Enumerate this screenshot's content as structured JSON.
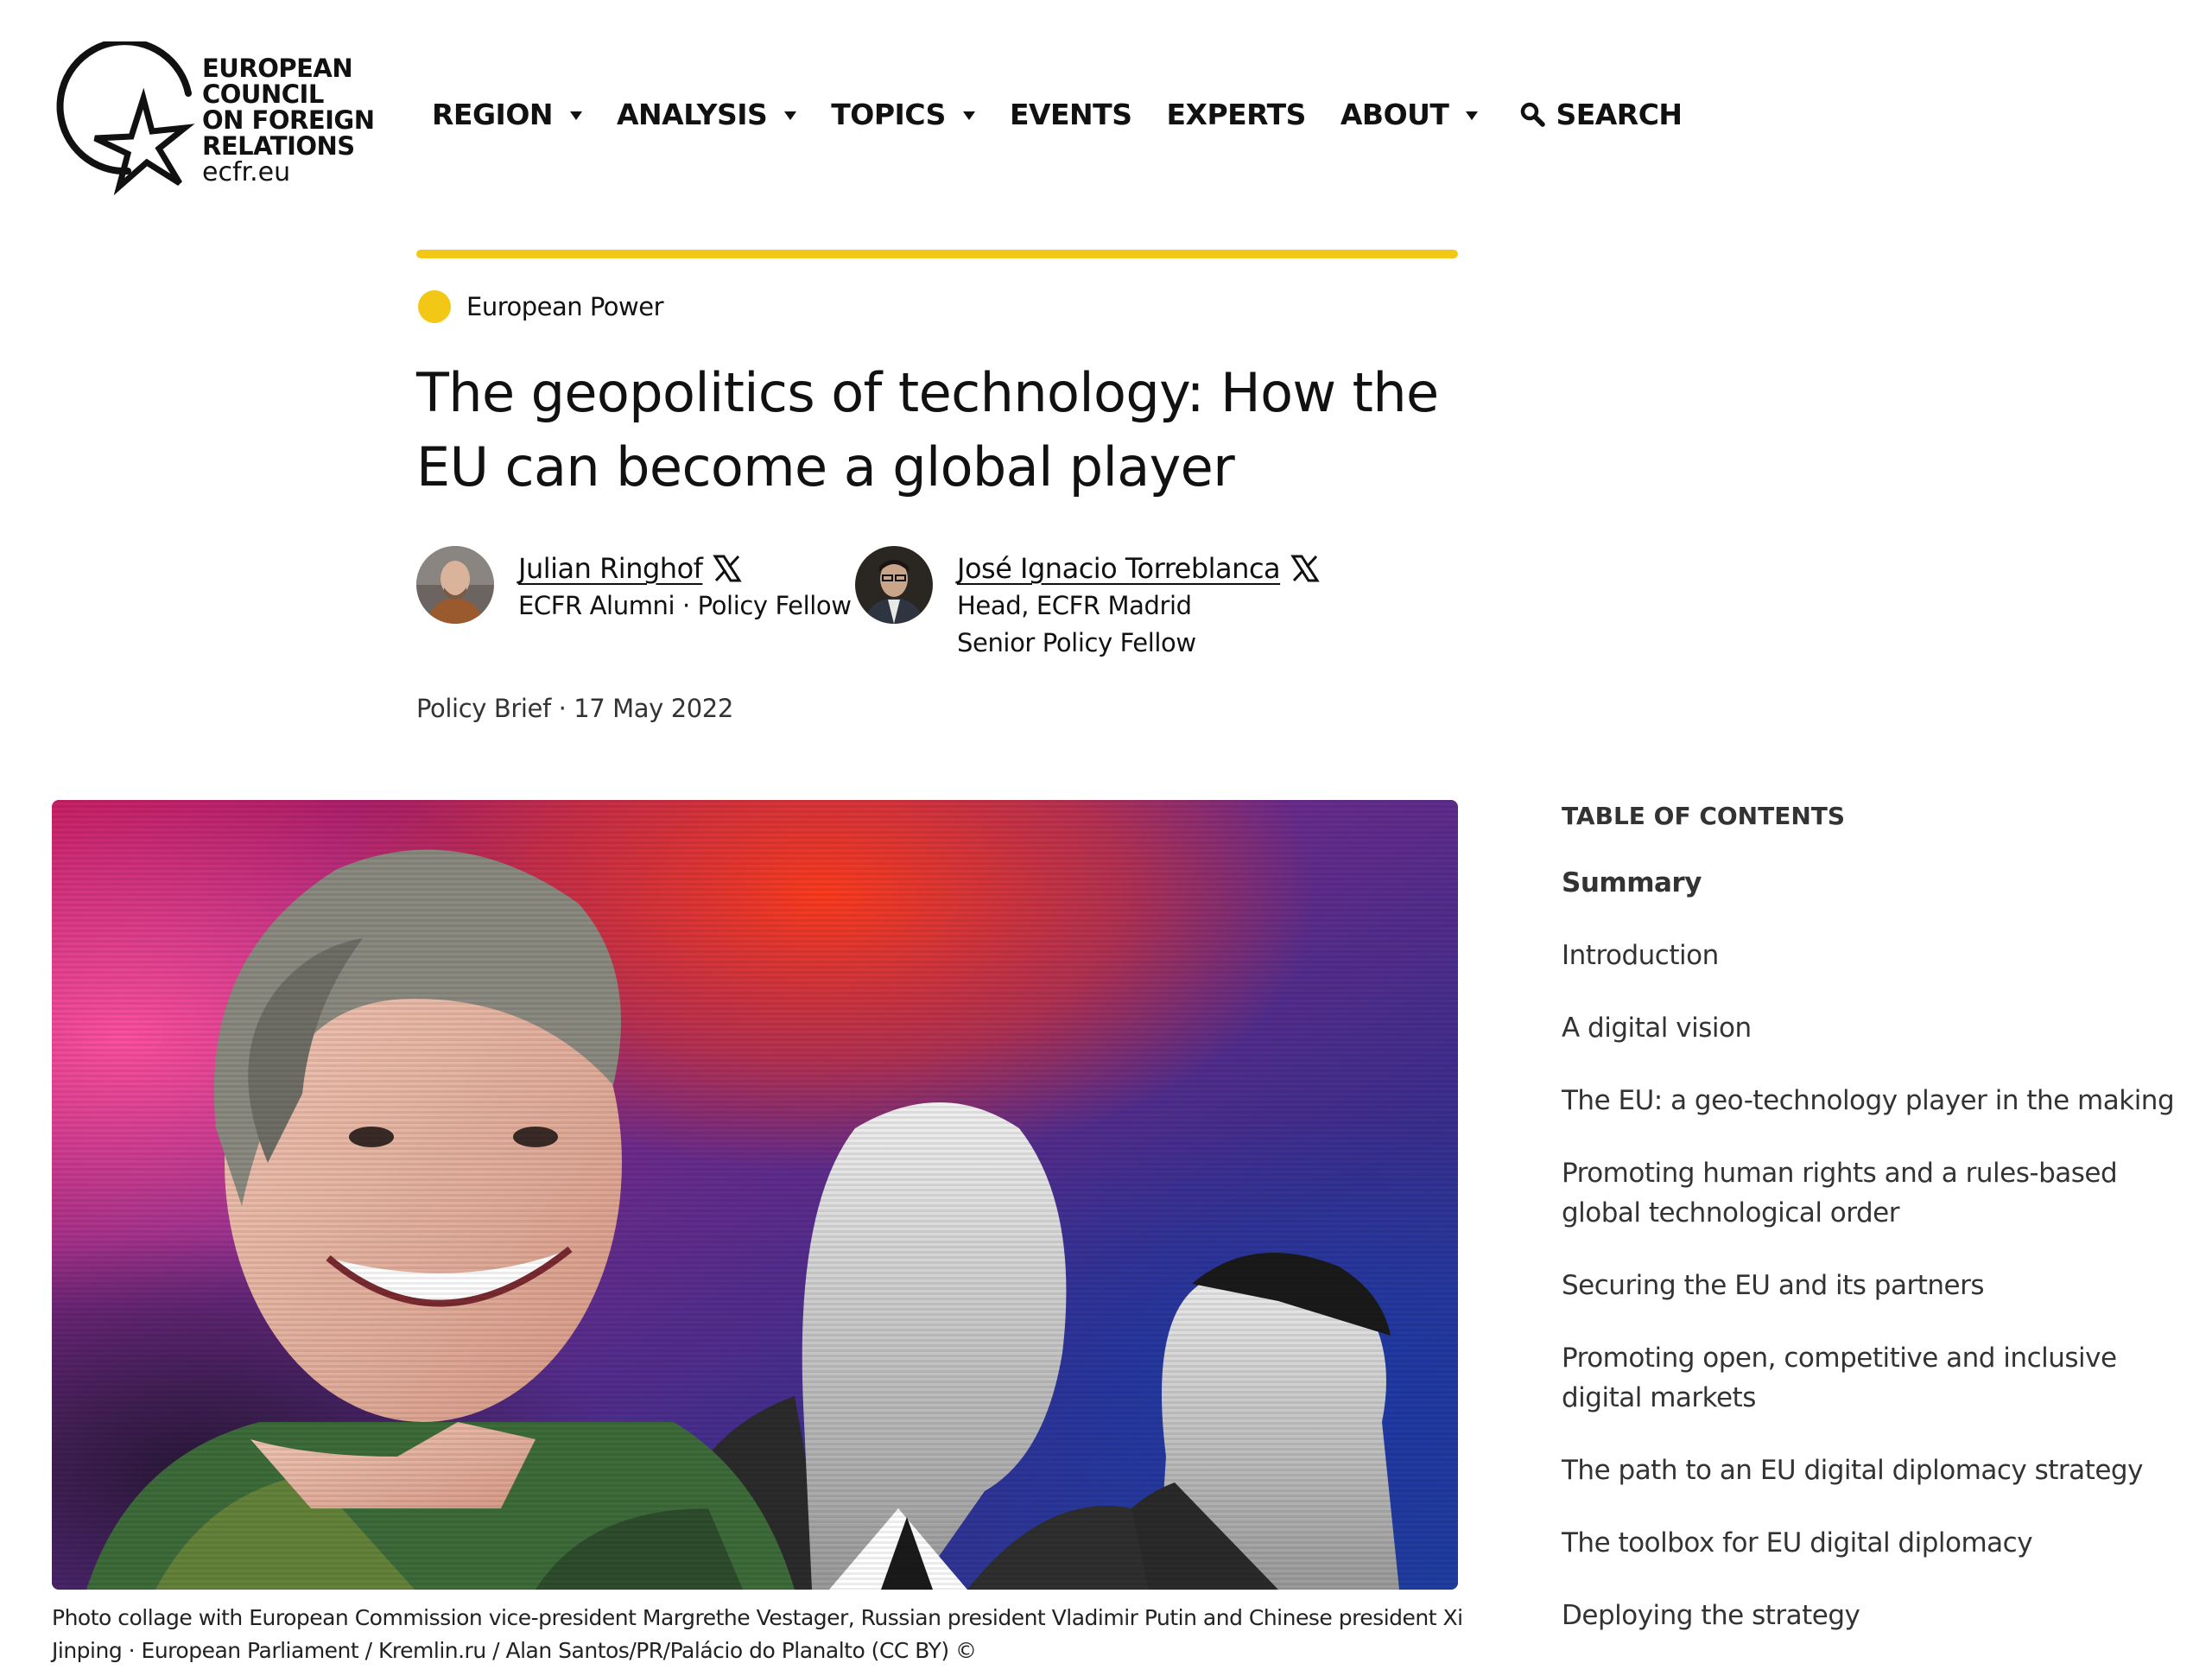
{
  "colors": {
    "accent": "#f2c716",
    "text": "#111111"
  },
  "logo": {
    "lines": [
      "EUROPEAN",
      "COUNCIL",
      "ON FOREIGN",
      "RELATIONS"
    ],
    "domain": "ecfr.eu"
  },
  "nav": {
    "items": [
      {
        "label": "REGION",
        "dropdown": true
      },
      {
        "label": "ANALYSIS",
        "dropdown": true
      },
      {
        "label": "TOPICS",
        "dropdown": true
      },
      {
        "label": "EVENTS",
        "dropdown": false
      },
      {
        "label": "EXPERTS",
        "dropdown": false
      },
      {
        "label": "ABOUT",
        "dropdown": true
      }
    ],
    "search_label": "SEARCH",
    "search_icon": "magnifier-icon"
  },
  "article": {
    "category": "European Power",
    "title": "The geopolitics of technology: How the EU can become a global player",
    "authors": [
      {
        "name": "Julian Ringhof",
        "roles": [
          "ECFR Alumni · Policy Fellow"
        ],
        "social_icon": "x-logo-icon"
      },
      {
        "name": "José Ignacio Torreblanca",
        "roles": [
          "Head, ECFR Madrid",
          "Senior Policy Fellow"
        ],
        "social_icon": "x-logo-icon"
      }
    ],
    "meta": "Policy Brief · 17 May 2022",
    "image_caption": "Photo collage with European Commission vice-president Margrethe Vestager, Russian president Vladimir Putin and Chinese president Xi Jinping · European Parliament / Kremlin.ru / Alan Santos/PR/Palácio do Planalto (CC BY) ©"
  },
  "toc": {
    "heading": "TABLE OF CONTENTS",
    "items": [
      "Summary",
      "Introduction",
      "A digital vision",
      "The EU: a geo-technology player in the making",
      "Promoting human rights and a rules-based global technological order",
      "Securing the EU and its partners",
      "Promoting open, competitive and inclusive digital markets",
      "The path to an EU digital diplomacy strategy",
      "The toolbox for EU digital diplomacy",
      "Deploying the strategy"
    ],
    "active_index": 0
  }
}
